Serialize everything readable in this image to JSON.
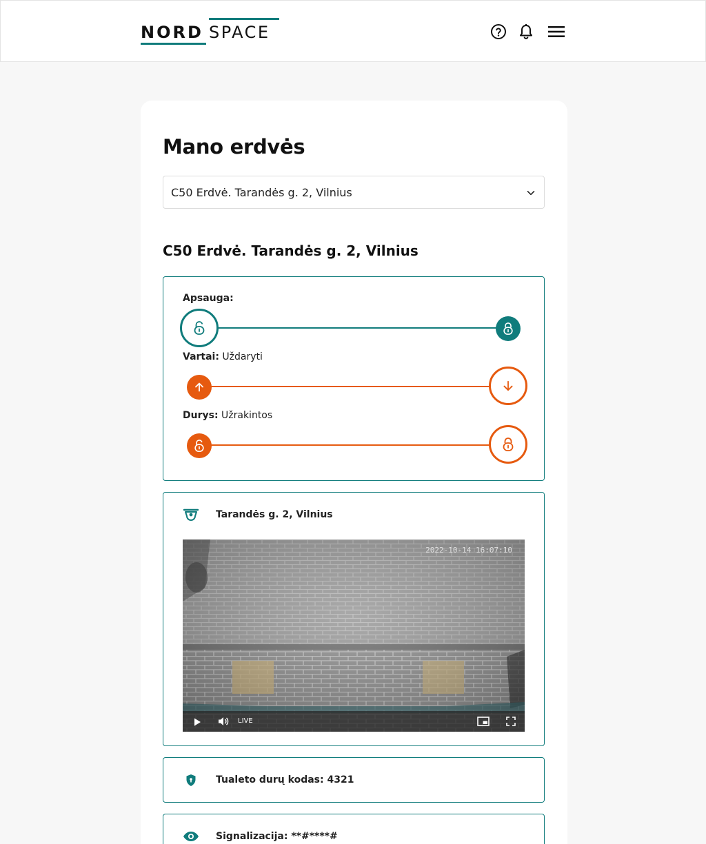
{
  "header": {
    "logo_bold": "NORD",
    "logo_light": "SPACE",
    "icons": [
      "help-icon",
      "bell-icon",
      "menu-icon"
    ],
    "brand_color": "#107c7c"
  },
  "page": {
    "title": "Mano erdvės",
    "space_select": {
      "value": "C50 Erdvė. Tarandės g. 2, Vilnius"
    },
    "space_title": "C50 Erdvė. Tarandės g. 2, Vilnius"
  },
  "controls": {
    "security": {
      "label": "Apsauga:",
      "status": "",
      "color": "#107c7c"
    },
    "gate": {
      "label": "Vartai:",
      "status": "Uždaryti",
      "color": "#e65a0f"
    },
    "door": {
      "label": "Durys:",
      "status": "Užrakintos",
      "color": "#e65a0f"
    }
  },
  "camera": {
    "title": "Tarandės g. 2, Vilnius",
    "timestamp": "2022-10-14 16:07:10",
    "live_label": "LIVE"
  },
  "toilet": {
    "text": "Tualeto durų kodas: 4321"
  },
  "alarm": {
    "text": "Signalizacija: **#****#"
  }
}
